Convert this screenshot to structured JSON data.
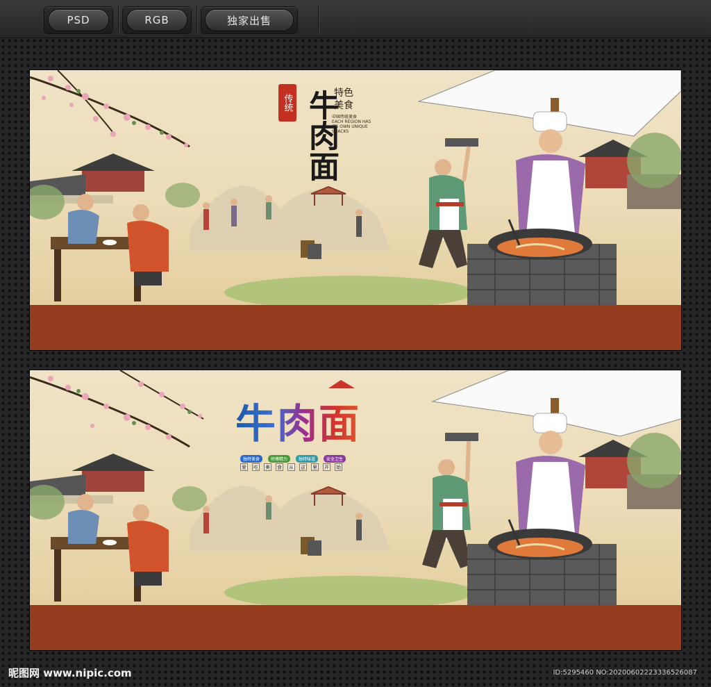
{
  "toolbar": {
    "tags": [
      {
        "label": "PSD"
      },
      {
        "label": "RGB"
      },
      {
        "label": "独家出售"
      }
    ]
  },
  "poster_top": {
    "seal_text": "传统",
    "title": "牛肉面",
    "subtitle": "特色美食",
    "caption_cn": "中国传统美食",
    "caption_en": "EACH REGION HAS ITS OWN UNIQUE SNACKS"
  },
  "poster_bottom": {
    "title": "牛肉面",
    "chips": [
      {
        "label": "独特美食",
        "color": "#2a68c9"
      },
      {
        "label": "师傅精力",
        "color": "#4a9a3a"
      },
      {
        "label": "独特味道",
        "color": "#2f9aa8"
      },
      {
        "label": "安全卫生",
        "color": "#8b3aa0"
      }
    ],
    "slogan": [
      "爱",
      "吃",
      "美",
      "食",
      "从",
      "这",
      "里",
      "开",
      "始"
    ]
  },
  "footer": {
    "logo": "昵图网 www.nipic.com",
    "meta": "ID:5295460 NO:20200602223336526087"
  },
  "colors": {
    "band": "#963c1e",
    "paper": "#ecdcb8"
  }
}
